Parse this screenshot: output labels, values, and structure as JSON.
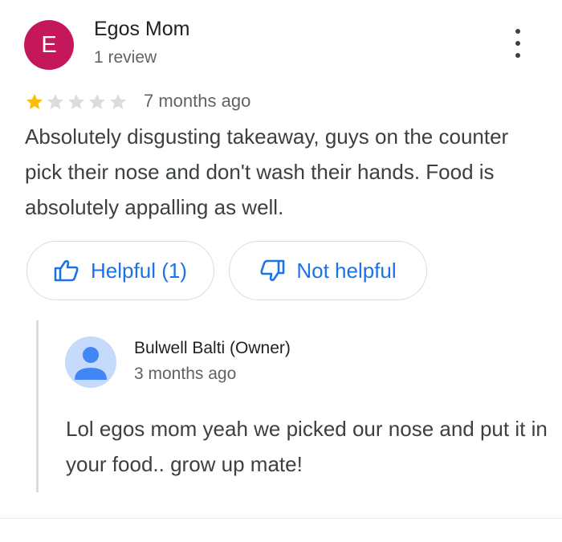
{
  "reviewer": {
    "initial": "E",
    "name": "Egos Mom",
    "review_count": "1 review",
    "avatar_color": "#c4185a"
  },
  "review": {
    "rating": 1,
    "max_rating": 5,
    "time": "7 months ago",
    "text": "Absolutely disgusting takeaway, guys on the counter pick their nose and don't wash their hands. Food is absolutely appalling as well."
  },
  "actions": {
    "helpful_label": "Helpful (1)",
    "not_helpful_label": "Not helpful",
    "accent_color": "#1a73e8"
  },
  "reply": {
    "owner_name": "Bulwell Balti (Owner)",
    "time": "3 months ago",
    "text": "Lol egos mom yeah we picked our nose and put it in your food.. grow up mate!"
  },
  "colors": {
    "star_filled": "#fbbc04",
    "star_empty": "#dadce0"
  }
}
